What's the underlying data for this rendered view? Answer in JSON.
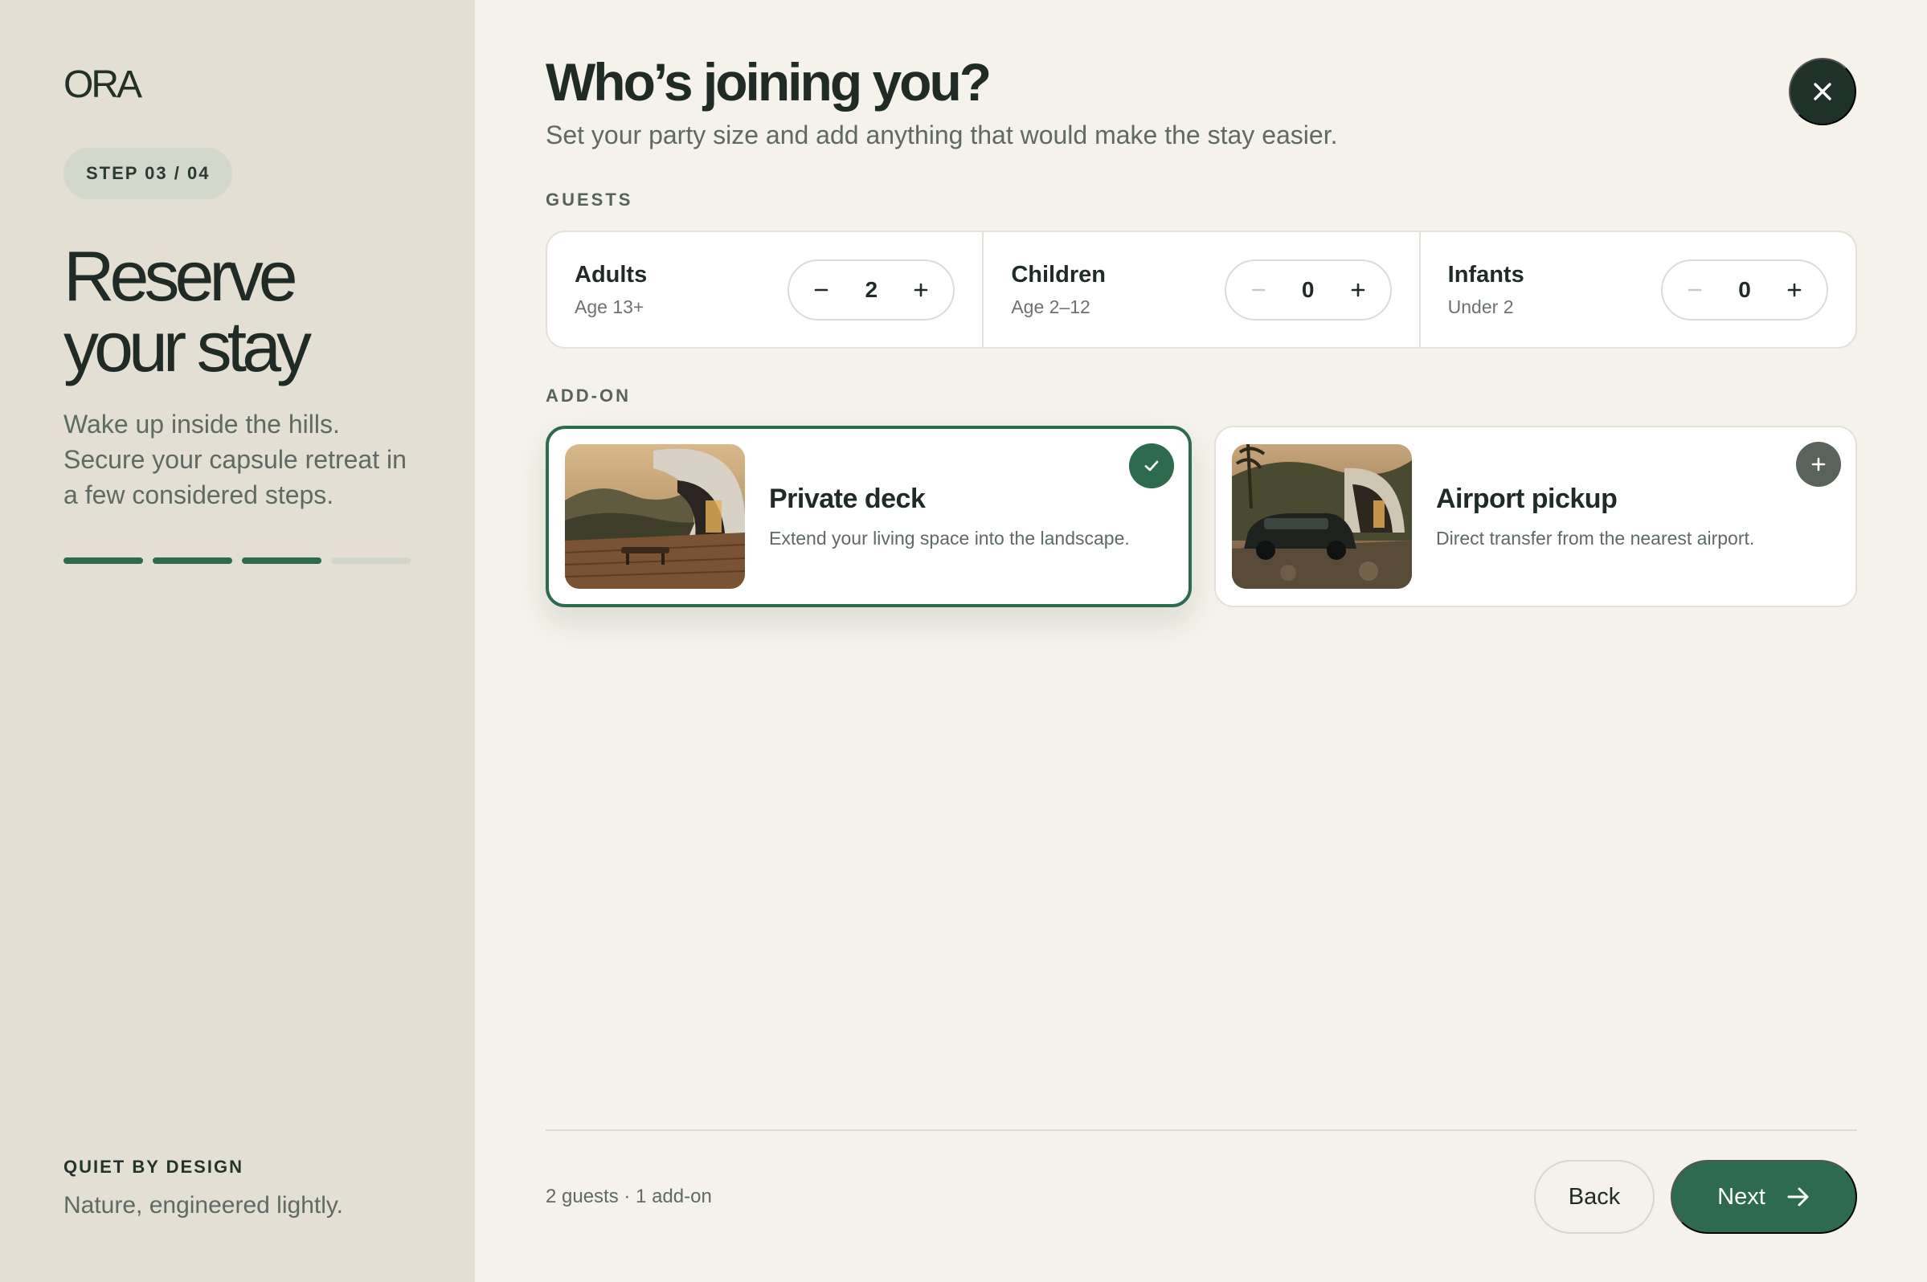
{
  "brand": "ORA",
  "sidebar": {
    "step_label": "STEP 03 / 04",
    "title": "Reserve your stay",
    "description": "Wake up inside the hills. Secure your capsule retreat in a few considered steps.",
    "progress": {
      "completed_steps": 3,
      "total_steps": 4
    },
    "tagline_label": "QUIET BY DESIGN",
    "tagline_text": "Nature, engineered lightly."
  },
  "header": {
    "title": "Who’s joining you?",
    "subtitle": "Set your party size and add anything that would make the stay easier.",
    "close_icon": "close-icon"
  },
  "guests": {
    "label": "GUESTS",
    "items": [
      {
        "name": "Adults",
        "sub": "Age 13+",
        "value": "2",
        "decrement_enabled": true
      },
      {
        "name": "Children",
        "sub": "Age 2–12",
        "value": "0",
        "decrement_enabled": false
      },
      {
        "name": "Infants",
        "sub": "Under 2",
        "value": "0",
        "decrement_enabled": false
      }
    ]
  },
  "addons": {
    "label": "ADD-ON",
    "items": [
      {
        "title": "Private deck",
        "description": "Extend your living space into the landscape.",
        "selected": true,
        "badge_icon": "check-icon"
      },
      {
        "title": "Airport pickup",
        "description": "Direct transfer from the nearest airport.",
        "selected": false,
        "badge_icon": "plus-icon"
      }
    ]
  },
  "footer": {
    "summary": "2 guests · 1 add-on",
    "back_label": "Back",
    "next_label": "Next",
    "next_icon": "arrow-right-icon"
  },
  "colors": {
    "accent": "#2e6b4e",
    "sidebar_bg": "#e4dfd3",
    "page_bg": "#f4f2ea",
    "dark": "#1f3128"
  }
}
